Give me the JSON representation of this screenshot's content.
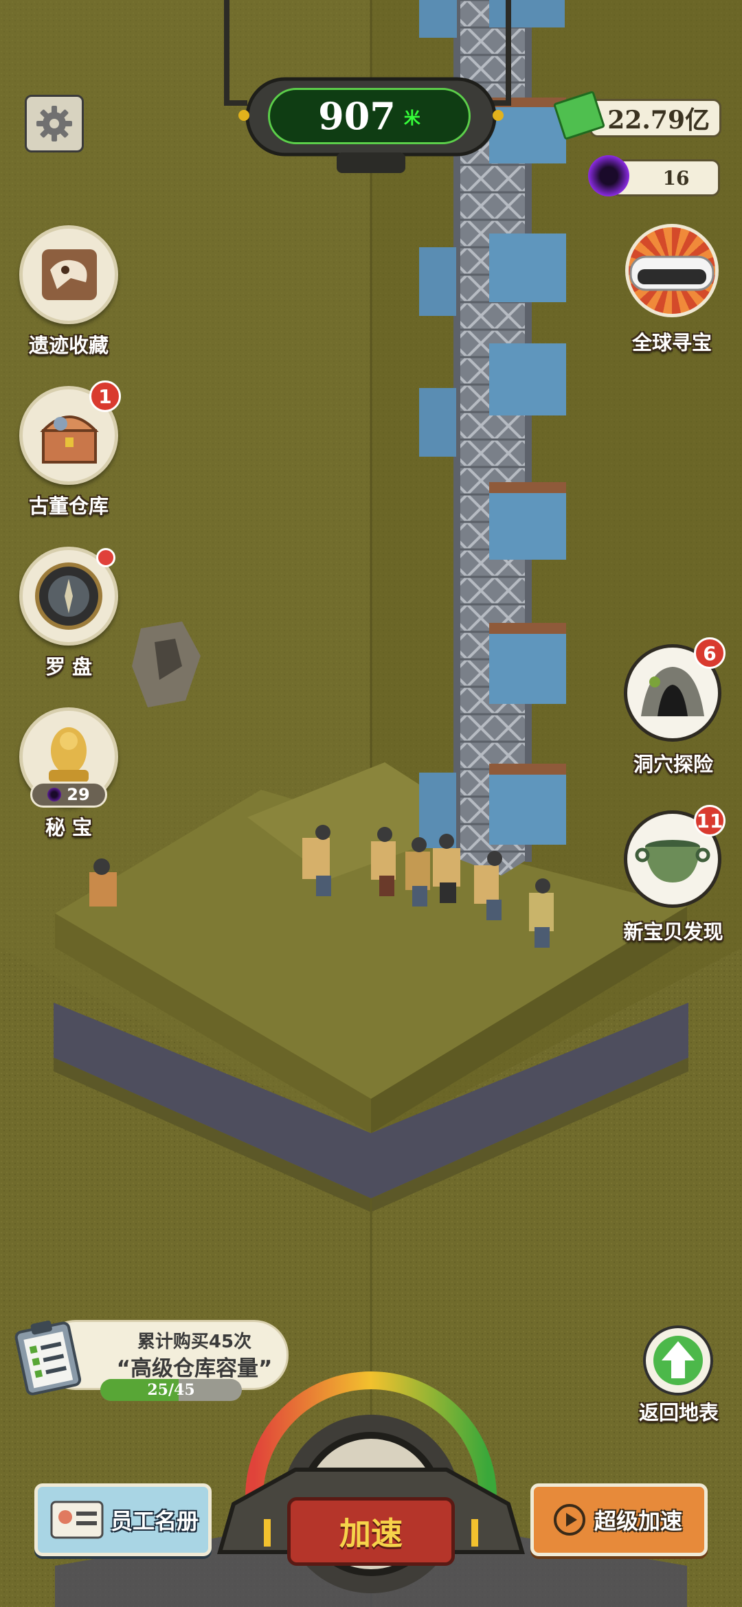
{
  "colors": {
    "terrain": "#6f6a2a",
    "rock": "#4e4e5e",
    "accent_green": "#36ff3a",
    "badge_red": "#d93a2f"
  },
  "depth": {
    "value": "907",
    "unit": "米"
  },
  "currency": {
    "money": "22.79亿",
    "portal": "16"
  },
  "left_menu": {
    "relic_collection": "遗迹收藏",
    "antique_warehouse": "古董仓库",
    "antique_warehouse_badge": "1",
    "compass": "罗 盘",
    "secret_treasure": "秘 宝",
    "secret_treasure_count": "29"
  },
  "right_menu": {
    "global_treasure": "全球寻宝",
    "cave_explore": "洞穴探险",
    "cave_explore_badge": "6",
    "new_treasure": "新宝贝发现",
    "new_treasure_badge": "11",
    "return_surface": "返回地表"
  },
  "quest": {
    "line1": "累计购买45次",
    "line2": "“高级仓库容量”",
    "progress_text": "25/45",
    "progress": 0.5556
  },
  "bottom": {
    "staff_roster": "员工名册",
    "speed_up": "加速",
    "super_speed_up": "超级加速"
  },
  "icons": {
    "settings": "gear-icon",
    "money": "cash-icon",
    "portal": "purple-portal-icon",
    "relic": "dinosaur-fossil-icon",
    "warehouse": "treasure-chest-icon",
    "compass": "compass-icon",
    "secret": "golden-buddha-icon",
    "global": "vr-headset-icon",
    "cave": "cave-icon",
    "new_treasure": "bronze-cauldron-icon",
    "return": "up-arrow-icon",
    "quest": "clipboard-icon",
    "staff": "id-card-icon",
    "super": "play-icon"
  }
}
